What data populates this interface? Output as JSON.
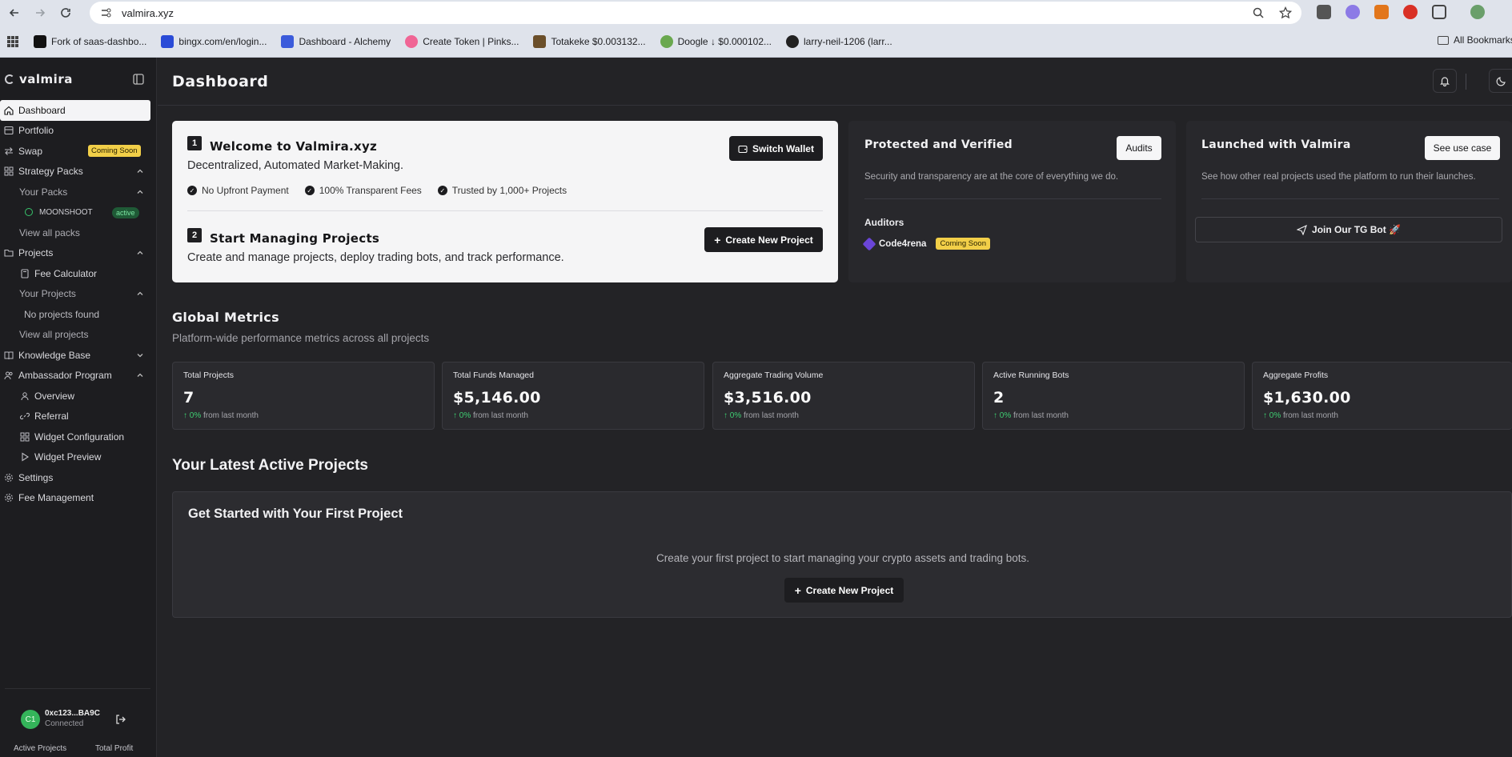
{
  "browser": {
    "url": "valmira.xyz",
    "bookmarks": [
      {
        "label": "Fork of saas-dashbo...",
        "color": "#111111"
      },
      {
        "label": "bingx.com/en/login...",
        "color": "#2a4bd7"
      },
      {
        "label": "Dashboard - Alchemy",
        "color": "#3b5bdb"
      },
      {
        "label": "Create Token | Pinks...",
        "color": "#f06595"
      },
      {
        "label": "Totakeke $0.003132...",
        "color": "#6b4f2a"
      },
      {
        "label": "Doogle ↓ $0.000102...",
        "color": "#6aa84f"
      },
      {
        "label": "larry-neil-1206 (larr...",
        "color": "#222222"
      }
    ],
    "all_bookmarks": "All Bookmarks"
  },
  "sidebar": {
    "brand": "valmira",
    "items": {
      "dashboard": "Dashboard",
      "portfolio": "Portfolio",
      "swap": "Swap",
      "swap_badge": "Coming Soon",
      "strategy_packs": "Strategy Packs",
      "your_packs": "Your Packs",
      "pack_name": "MOONSHOOT",
      "pack_status": "active",
      "view_all_packs": "View all packs",
      "projects": "Projects",
      "fee_calculator": "Fee Calculator",
      "your_projects": "Your Projects",
      "no_projects": "No projects found",
      "view_all_projects": "View all projects",
      "knowledge_base": "Knowledge Base",
      "ambassador": "Ambassador Program",
      "overview": "Overview",
      "referral": "Referral",
      "widget_config": "Widget Configuration",
      "widget_preview": "Widget Preview",
      "settings": "Settings",
      "fee_management": "Fee Management"
    },
    "wallet": {
      "avatar": "C1",
      "address": "0xc123...BA9C",
      "status": "Connected"
    },
    "footer": {
      "active_projects": "Active Projects",
      "total_profit": "Total Profit"
    }
  },
  "header": {
    "title": "Dashboard"
  },
  "welcome": {
    "step1_num": "1",
    "step1_title": "Welcome to Valmira.xyz",
    "step1_sub": "Decentralized, Automated Market-Making.",
    "checks": [
      "No Upfront Payment",
      "100% Transparent Fees",
      "Trusted by 1,000+ Projects"
    ],
    "switch_wallet": "Switch Wallet",
    "step2_num": "2",
    "step2_title": "Start Managing Projects",
    "step2_sub": "Create and manage projects, deploy trading bots, and track performance.",
    "create_project": "Create New Project"
  },
  "protected": {
    "title": "Protected and Verified",
    "button": "Audits",
    "desc": "Security and transparency are at the core of everything we do.",
    "auditors_label": "Auditors",
    "auditor_name": "Code4rena",
    "auditor_badge": "Coming Soon"
  },
  "launched": {
    "title": "Launched with Valmira",
    "button": "See use case",
    "desc": "See how other real projects used the platform to run their launches.",
    "tg_button": "Join Our TG Bot 🚀"
  },
  "metrics": {
    "title": "Global Metrics",
    "subtitle": "Platform-wide performance metrics across all projects",
    "cards": [
      {
        "label": "Total Projects",
        "value": "7",
        "change": "0%",
        "period": "from last month"
      },
      {
        "label": "Total Funds Managed",
        "value": "$5,146.00",
        "change": "0%",
        "period": "from last month"
      },
      {
        "label": "Aggregate Trading Volume",
        "value": "$3,516.00",
        "change": "0%",
        "period": "from last month"
      },
      {
        "label": "Active Running Bots",
        "value": "2",
        "change": "0%",
        "period": "from last month"
      },
      {
        "label": "Aggregate Profits",
        "value": "$1,630.00",
        "change": "0%",
        "period": "from last month"
      }
    ]
  },
  "latest": {
    "title": "Your Latest Active Projects",
    "card_title": "Get Started with Your First Project",
    "card_desc": "Create your first project to start managing your crypto assets and trading bots.",
    "card_button": "Create New Project"
  }
}
